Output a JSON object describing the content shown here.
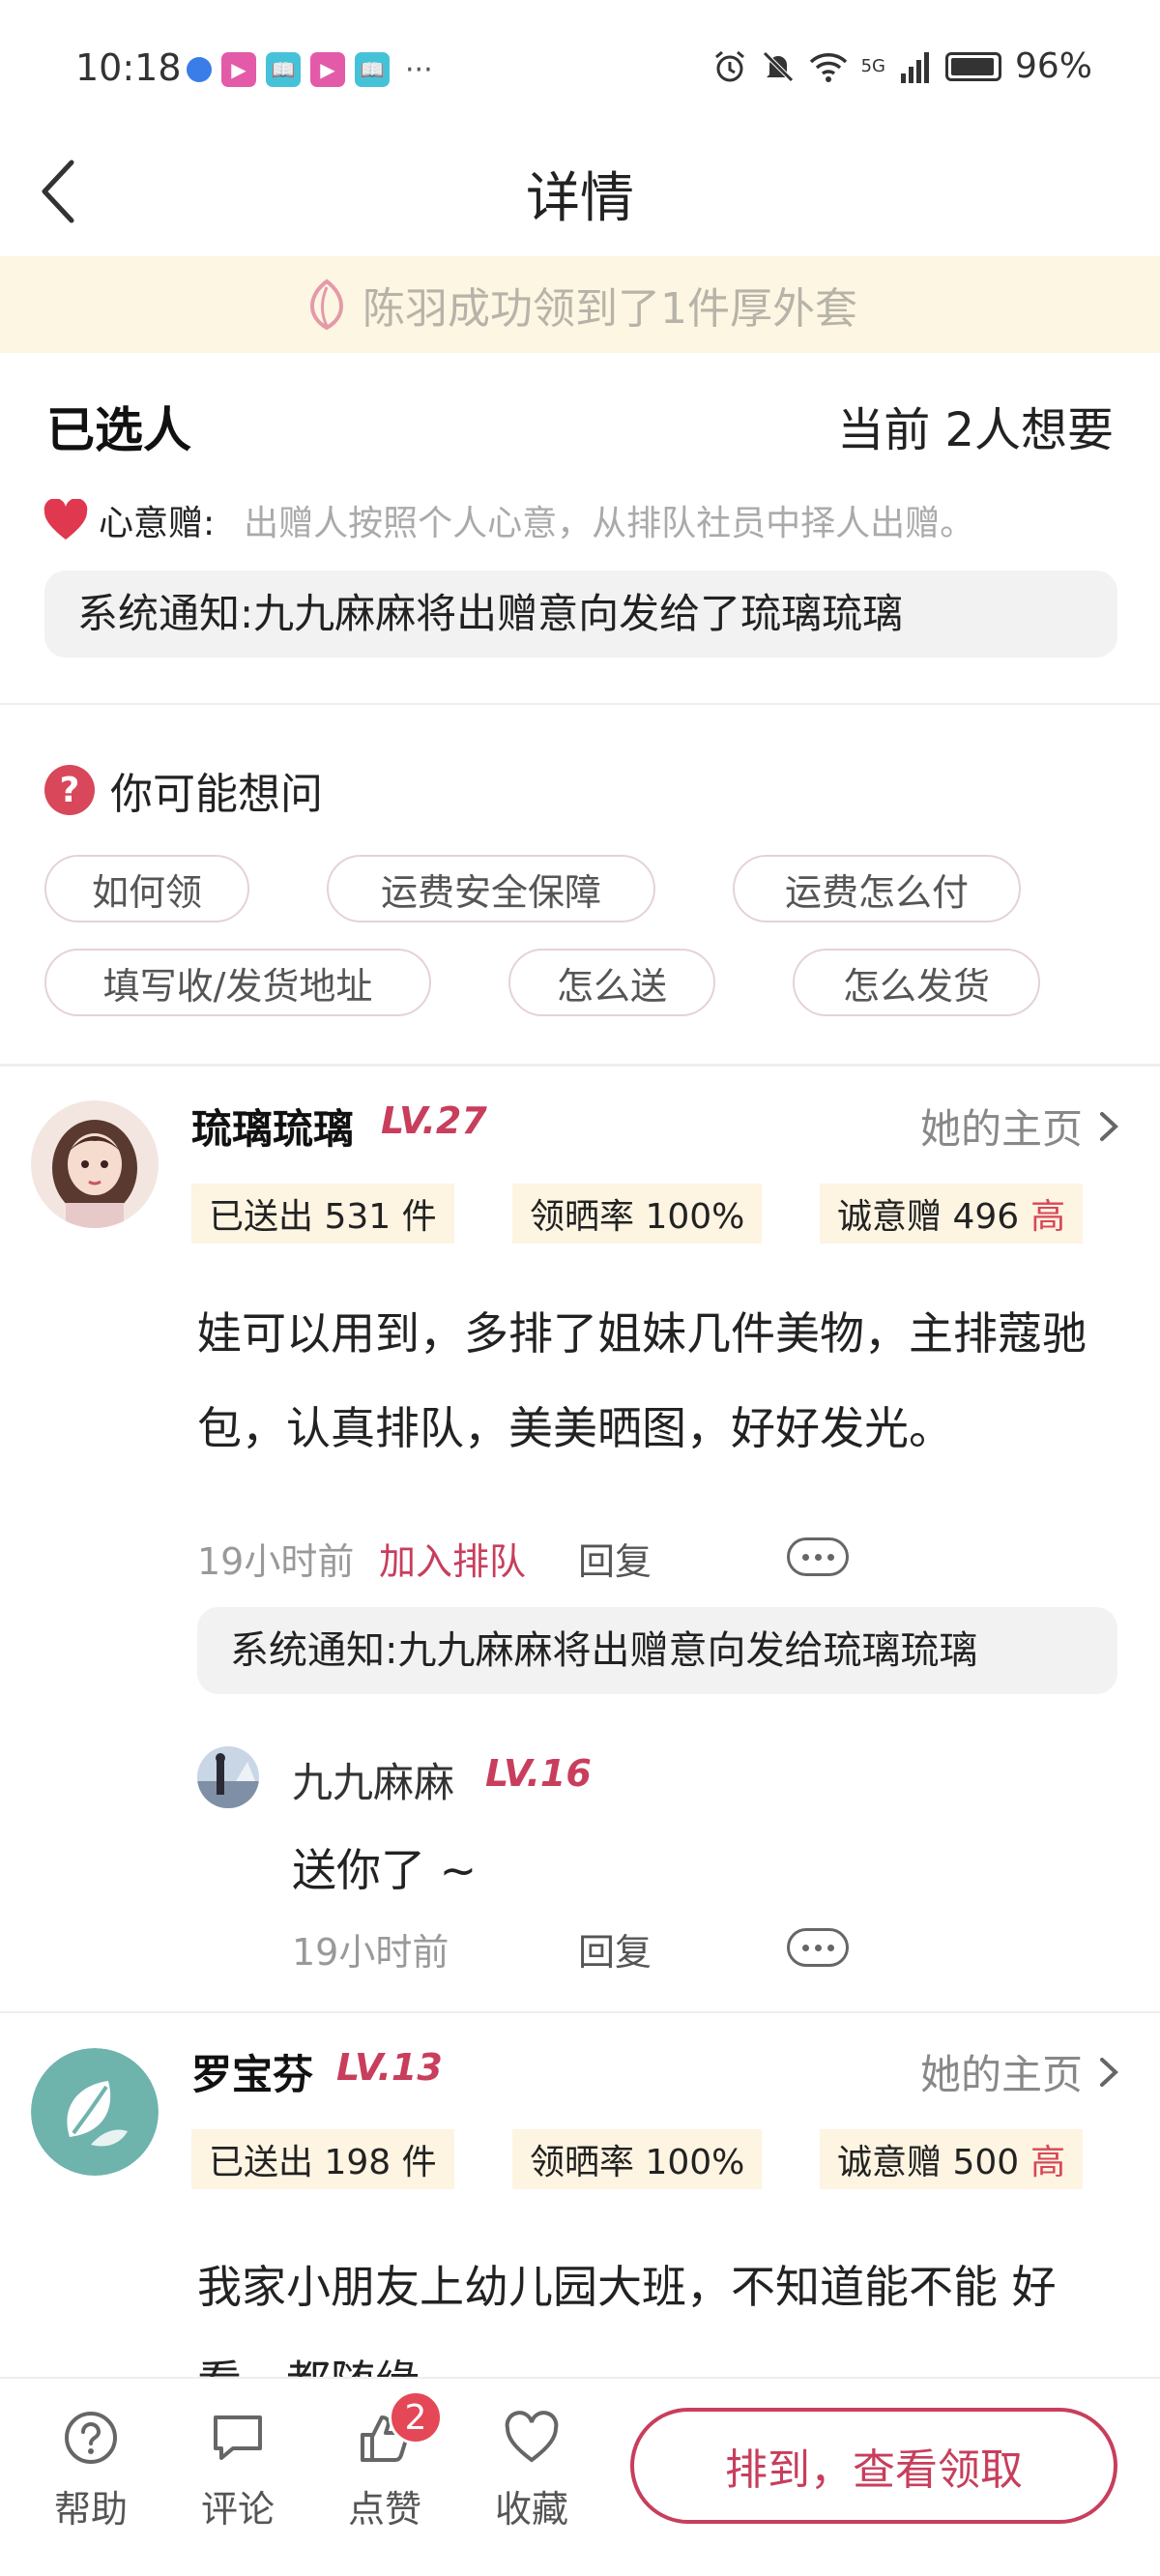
{
  "status_bar": {
    "time": "10:18",
    "apps": [
      "▶",
      "📖",
      "▶",
      "📖"
    ],
    "more": "···",
    "network": "5G",
    "battery": "96%"
  },
  "nav": {
    "title": "详情"
  },
  "banner": {
    "text": "陈羽成功领到了1件厚外套"
  },
  "selected": {
    "title": "已选人",
    "count": "当前 2人想要",
    "mode_label": "心意赠:",
    "mode_desc": "出赠人按照个人心意，从排队社员中择人出赠。",
    "system_notice": "系统通知:九九麻麻将出赠意向发给了琉璃琉璃"
  },
  "faq": {
    "title": "你可能想问",
    "chips": [
      "如何领",
      "运费安全保障",
      "运费怎么付",
      "填写收/发货地址",
      "怎么送",
      "怎么发货"
    ]
  },
  "comments": [
    {
      "name": "琉璃琉璃",
      "level": "LV.27",
      "home": "她的主页",
      "sent": "已送出 531 件",
      "claim_rate": "领晒率 100%",
      "sincerity": "诚意赠 496",
      "sincerity_level": "高",
      "text": "娃可以用到，多排了姐妹几件美物，主排蔻驰包，认真排队，美美晒图，好好发光。",
      "time": "19小时前",
      "action": "加入排队",
      "reply": "回复",
      "system_note": "系统通知:九九麻麻将出赠意向发给琉璃琉璃",
      "sub_reply": {
        "name": "九九麻麻",
        "level": "LV.16",
        "text": "送你了 ~",
        "time": "19小时前",
        "reply": "回复"
      }
    },
    {
      "name": "罗宝芬",
      "level": "LV.13",
      "home": "她的主页",
      "sent": "已送出 198 件",
      "claim_rate": "领晒率 100%",
      "sincerity": "诚意赠 500",
      "sincerity_level": "高",
      "text": "我家小朋友上幼儿园大班，不知道能不能 好看，都随缘"
    }
  ],
  "bottom_bar": {
    "help": "帮助",
    "comment": "评论",
    "like": "点赞",
    "like_count": "2",
    "favorite": "收藏",
    "cta": "排到，查看领取"
  },
  "colors": {
    "accent": "#c83e5c",
    "banner_bg": "#fcf6e3",
    "tag_bg": "#fdf4e2"
  }
}
